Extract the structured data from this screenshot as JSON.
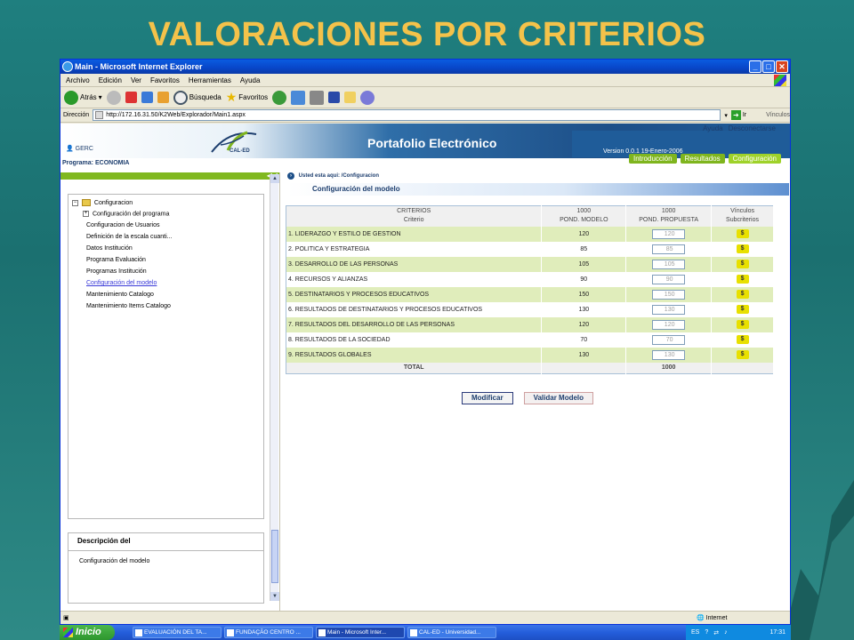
{
  "slide": {
    "title": "VALORACIONES POR CRITERIOS"
  },
  "window": {
    "title": "Main - Microsoft Internet Explorer",
    "menu": [
      "Archivo",
      "Edición",
      "Ver",
      "Favoritos",
      "Herramientas",
      "Ayuda"
    ],
    "toolbar": {
      "back": "Atrás",
      "search": "Búsqueda",
      "favorites": "Favoritos"
    },
    "address": {
      "label": "Dirección",
      "url": "http://172.16.31.50/K2Web/Explorador/Main1.aspx",
      "go": "Ir",
      "links": "Vínculos"
    },
    "status": {
      "zone": "Internet"
    }
  },
  "app": {
    "user": "GERC",
    "logo_text": "CAL-ED",
    "title": "Portafolio Electrónico",
    "help": "Ayuda",
    "logout": "Desconectarse",
    "version": "Version 0.0.1    19-Enero-2006",
    "program_label": "Programa:",
    "program_value": "ECONOMIA",
    "tabs": [
      "Introducción",
      "Resultados",
      "Configuración"
    ]
  },
  "tree": {
    "root": "Configuracion",
    "items": [
      "Configuración del programa",
      "Configuracion de Usuarios",
      "Definición de la escala cuanti...",
      "Datos Institución",
      "Programa Evaluación",
      "Programas Institución",
      "Configuración del modelo",
      "Mantenimiento Catalogo",
      "Mantenimiento Items Catalogo"
    ]
  },
  "description": {
    "title": "Descripción del",
    "text": "Configuración del modelo"
  },
  "main": {
    "breadcrumb": "Usted esta aqui: /Configuracion",
    "section_title": "Configuración del modelo",
    "table": {
      "headers": {
        "c1_top": "CRITERIOS",
        "c1_bottom": "Criterio",
        "c2_top": "1000",
        "c2_bottom": "POND. MODELO",
        "c3_top": "1000",
        "c3_bottom": "POND. PROPUESTA",
        "c4_top": "Vínculos",
        "c4_bottom": "Subcriterios"
      },
      "rows": [
        {
          "name": "1. LIDERAZGO Y ESTILO DE GESTION",
          "model": "120",
          "proposal": "120"
        },
        {
          "name": "2. POLITICA Y ESTRATEGIA",
          "model": "85",
          "proposal": "85"
        },
        {
          "name": "3. DESARROLLO DE LAS PERSONAS",
          "model": "105",
          "proposal": "105"
        },
        {
          "name": "4. RECURSOS Y ALIANZAS",
          "model": "90",
          "proposal": "90"
        },
        {
          "name": "5. DESTINATARIOS Y PROCESOS EDUCATIVOS",
          "model": "150",
          "proposal": "150"
        },
        {
          "name": "6. RESULTADOS DE DESTINATARIOS Y PROCESOS EDUCATIVOS",
          "model": "130",
          "proposal": "130"
        },
        {
          "name": "7. RESULTADOS DEL DESARROLLO DE LAS PERSONAS",
          "model": "120",
          "proposal": "120"
        },
        {
          "name": "8. RESULTADOS DE LA SOCIEDAD",
          "model": "70",
          "proposal": "70"
        },
        {
          "name": "9. RESULTADOS GLOBALES",
          "model": "130",
          "proposal": "130"
        }
      ],
      "link_symbol": "$",
      "total_label": "TOTAL",
      "total_value": "1000"
    },
    "buttons": {
      "modify": "Modificar",
      "validate": "Validar Modelo"
    }
  },
  "taskbar": {
    "start": "Inicio",
    "items": [
      "EVALUACIÓN DEL TA...",
      "FUNDAÇÃO CENTRO ...",
      "Main - Microsoft Inter...",
      "CAL-ED - Universidad..."
    ],
    "lang": "ES",
    "clock": "17:31"
  }
}
